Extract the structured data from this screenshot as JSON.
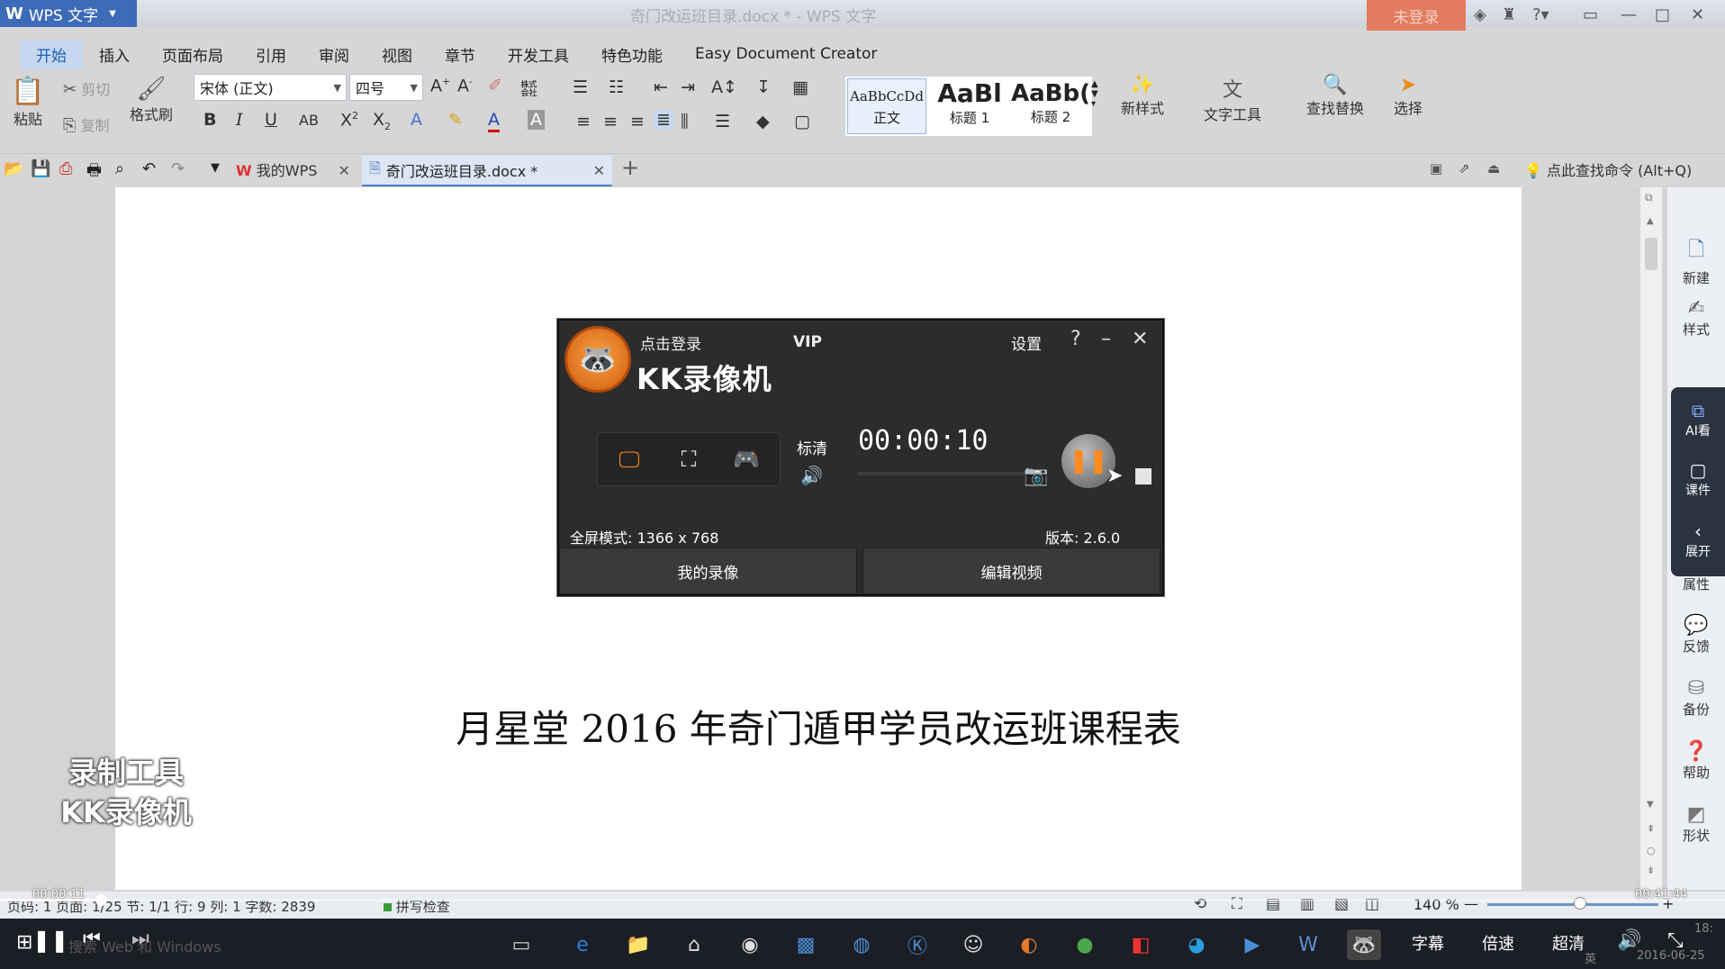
{
  "titlebar": {
    "app_name": "WPS 文字",
    "doc_title": "奇门改运班目录.docx * - WPS 文字",
    "login": "未登录"
  },
  "ribbon": {
    "tabs": [
      "开始",
      "插入",
      "页面布局",
      "引用",
      "审阅",
      "视图",
      "章节",
      "开发工具",
      "特色功能",
      "Easy Document Creator"
    ],
    "paste": "粘贴",
    "cut": "剪切",
    "copy": "复制",
    "format_painter": "格式刷",
    "font_name": "宋体 (正文)",
    "font_size": "四号",
    "styles": [
      {
        "preview": "AaBbCcDd",
        "name": "正文"
      },
      {
        "preview": "AaBl",
        "name": "标题 1"
      },
      {
        "preview": "AaBb(",
        "name": "标题 2"
      }
    ],
    "new_style": "新样式",
    "text_tools": "文字工具",
    "find_replace": "查找替换",
    "select": "选择"
  },
  "doc_tabs": {
    "my_wps": "我的WPS",
    "current_doc": "奇门改运班目录.docx *",
    "find_command": "点此查找命令 (Alt+Q)"
  },
  "document": {
    "heading": "月星堂 2016 年奇门遁甲学员改运班课程表"
  },
  "watermark": {
    "line1": "录制工具",
    "line2": "KK录像机"
  },
  "right_panel": {
    "items": [
      "新建",
      "样式",
      "属性",
      "反馈",
      "备份",
      "帮助",
      "形状"
    ],
    "dark_items": [
      "AI看",
      "课件",
      "展开"
    ]
  },
  "kk": {
    "login": "点击登录",
    "vip": "VIP",
    "name": "KK录像机",
    "settings": "设置",
    "help": "?",
    "quality": "标清",
    "timer": "00:00:10",
    "mode": "全屏模式: 1366 x 768",
    "version": "版本: 2.6.0",
    "my_recordings": "我的录像",
    "edit_video": "编辑视频"
  },
  "status": {
    "text": "页码: 1  页面: 1/25  节: 1/1  行: 9  列: 1  字数: 2839",
    "spell": "拼写检查",
    "zoom": "140 %"
  },
  "player": {
    "elapsed": "00:00:11",
    "total": "00:41:44",
    "subtitles": "字幕",
    "speed": "倍速",
    "quality": "超清"
  },
  "taskbar": {
    "search_placeholder": "搜索 Web 和 Windows",
    "clock": "18:",
    "date": "2016-06-25",
    "ime": "英"
  }
}
